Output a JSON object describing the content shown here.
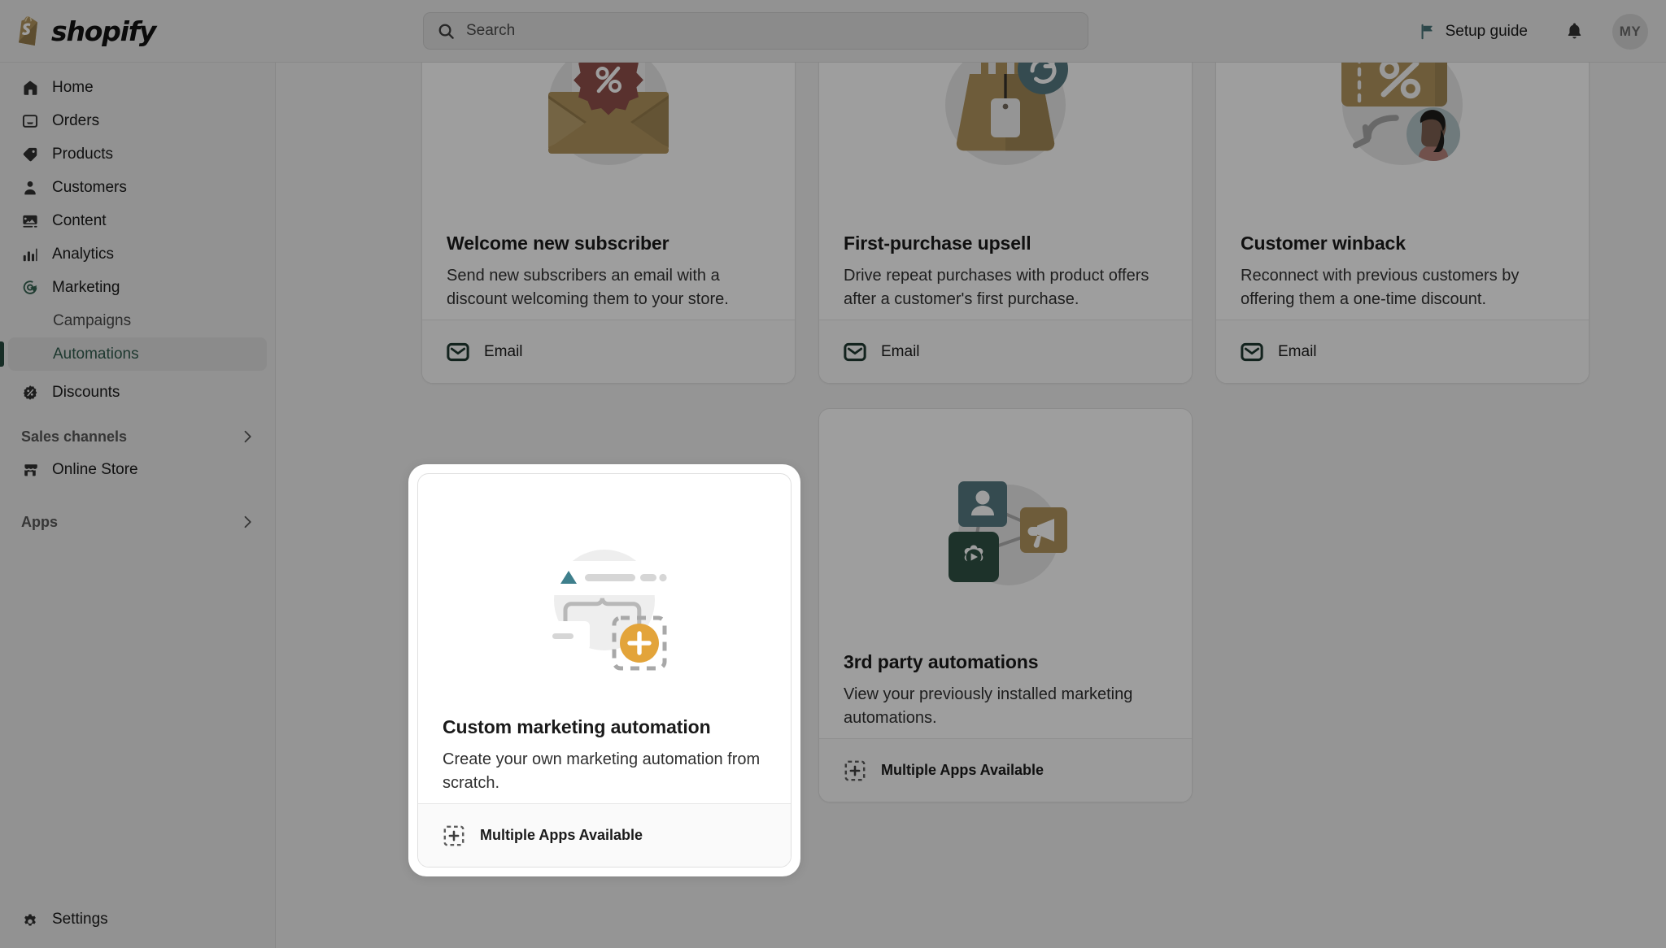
{
  "topbar": {
    "brand": "shopify",
    "brand_logo_icon": "shopify-bag-logo",
    "search": {
      "placeholder": "Search",
      "value": "",
      "icon": "search-icon"
    },
    "setup_guide": {
      "label": "Setup guide",
      "icon": "flag-icon",
      "color": "#2a7a82"
    },
    "notifications": {
      "icon": "bell-icon"
    },
    "account": {
      "initials": "MY",
      "icon": "avatar"
    }
  },
  "sidebar": {
    "items": [
      {
        "label": "Home",
        "icon": "home-icon"
      },
      {
        "label": "Orders",
        "icon": "orders-inbox-icon"
      },
      {
        "label": "Products",
        "icon": "product-tag-icon"
      },
      {
        "label": "Customers",
        "icon": "person-icon"
      },
      {
        "label": "Content",
        "icon": "image-content-icon"
      },
      {
        "label": "Analytics",
        "icon": "bar-chart-icon"
      },
      {
        "label": "Marketing",
        "icon": "marketing-target-icon",
        "icon_color": "#1a6b4c"
      }
    ],
    "marketing_children": [
      {
        "label": "Campaigns",
        "active": false
      },
      {
        "label": "Automations",
        "active": true
      }
    ],
    "after_items": [
      {
        "label": "Discounts",
        "icon": "discount-badge-icon"
      }
    ],
    "sections": [
      {
        "label": "Sales channels",
        "icon": "chevron-right-icon"
      },
      {
        "label": "Apps",
        "icon": "chevron-right-icon"
      }
    ],
    "channels": [
      {
        "label": "Online Store",
        "icon": "storefront-icon"
      }
    ],
    "settings": {
      "label": "Settings",
      "icon": "gear-icon"
    },
    "active_color": "#15644a",
    "active_bar_color": "#0f4f3a"
  },
  "main": {
    "cards": [
      {
        "title": "Welcome new subscriber",
        "description": "Send new subscribers an email with a discount welcoming them to your store.",
        "footer_label": "Email",
        "footer_icon": "email-envelope-icon",
        "illustration": "open-envelope-with-discount-badge",
        "highlighted": false
      },
      {
        "title": "First-purchase upsell",
        "description": "Drive repeat purchases with product offers after a customer's first purchase.",
        "footer_label": "Email",
        "footer_icon": "email-envelope-icon",
        "illustration": "shopping-bag-with-repeat-badge",
        "highlighted": false
      },
      {
        "title": "Customer winback",
        "description": "Reconnect with previous customers by offering them a one-time discount.",
        "footer_label": "Email",
        "footer_icon": "email-envelope-icon",
        "illustration": "discount-coupon-with-customer-avatar",
        "highlighted": false
      },
      {
        "title": "Custom marketing automation",
        "description": "Create your own marketing automation from scratch.",
        "footer_label": "Multiple Apps Available",
        "footer_icon": "dashed-plus-icon",
        "illustration": "workflow-builder-with-add-block",
        "highlighted": true
      },
      {
        "title": "3rd party automations",
        "description": "View your previously installed marketing automations.",
        "footer_label": "Multiple Apps Available",
        "footer_icon": "dashed-plus-icon",
        "illustration": "connected-app-tiles",
        "highlighted": false
      }
    ]
  },
  "colors": {
    "brand_green": "#1a6b4c",
    "accent_gold": "#c8932f",
    "accent_teal": "#3e7f8c",
    "accent_red": "#b8453c",
    "page_bg": "#f1f1f1",
    "chrome_bg": "#ebebeb"
  }
}
